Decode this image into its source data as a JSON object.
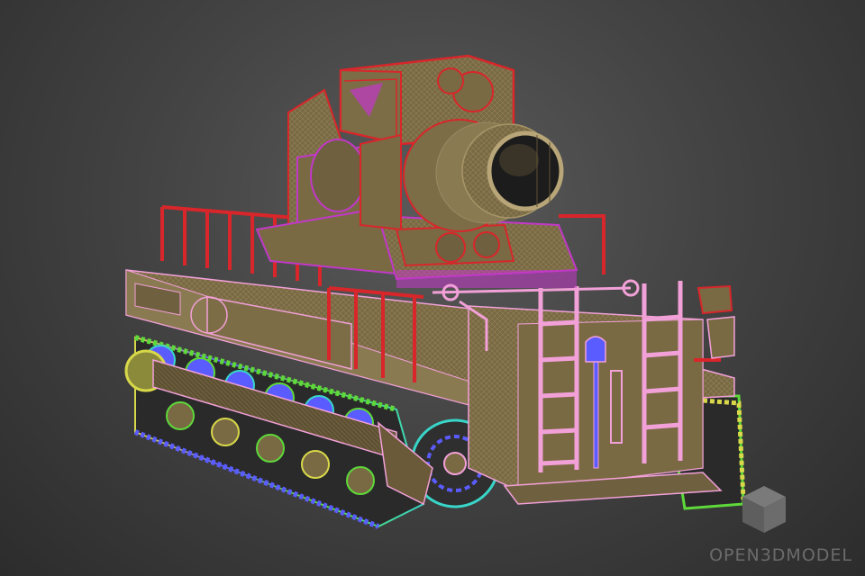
{
  "scene": {
    "subject": "wireframe-tracked-mortar-model",
    "background_color": "#3a3a3a"
  },
  "colors": {
    "body": "#7a6a44",
    "body_dark": "#5f5234",
    "red_wire": "#d8262a",
    "pink_wire": "#f2a0d8",
    "magenta_wire": "#c238c8",
    "track_blue": "#5b5cff",
    "track_green": "#5ed83a",
    "track_yellow": "#d8d84a",
    "track_cyan": "#38d6c8"
  },
  "watermark": {
    "text": "OPEN3DMODEL",
    "icon": "cube-logo-icon"
  }
}
